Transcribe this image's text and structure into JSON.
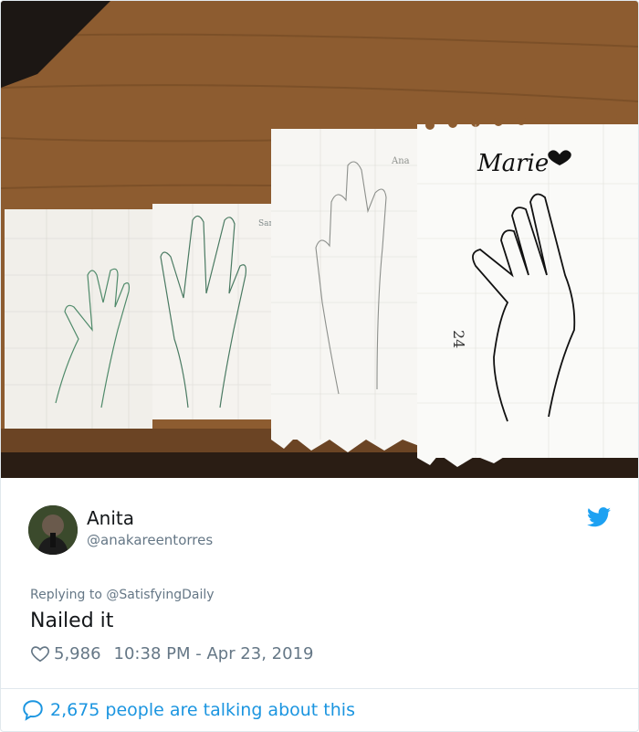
{
  "tweet": {
    "author_name": "Anita",
    "author_handle": "@anakareentorres",
    "reply_prefix": "Replying to",
    "reply_to": "@SatisfyingDaily",
    "text": "Nailed it",
    "likes": "5,986",
    "timestamp": "10:38 PM - Apr 23, 2019",
    "conversation": "2,675 people are talking about this"
  },
  "photo": {
    "paper_labels": [
      "Sara",
      "Ana",
      "Marie",
      "24"
    ]
  },
  "icons": {
    "brand": "twitter-bird-icon",
    "like": "heart-icon",
    "conversation": "speech-bubble-icon"
  },
  "colors": {
    "twitter_blue": "#1da1f2",
    "link_blue": "#1b95e0",
    "secondary_text": "#657786",
    "border": "#e1e8ed",
    "desk_wood": "#8a5a2e"
  }
}
